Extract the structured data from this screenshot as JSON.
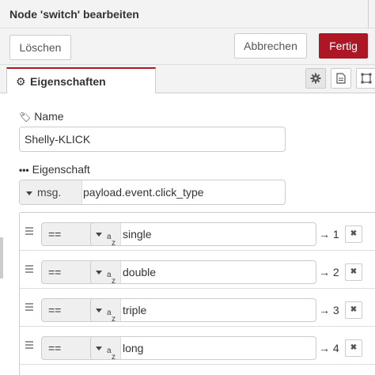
{
  "dialog": {
    "title": "Node 'switch' bearbeiten"
  },
  "actions": {
    "delete_label": "Löschen",
    "cancel_label": "Abbrechen",
    "done_label": "Fertig"
  },
  "tabs": {
    "properties_label": "Eigenschaften",
    "icons": [
      "gear-icon",
      "description-icon",
      "appearance-icon"
    ]
  },
  "form": {
    "name_label": "Name",
    "name_value": "Shelly-KLICK",
    "property_label": "Eigenschaft",
    "property_type": "msg.",
    "property_value": "payload.event.click_type"
  },
  "rules": [
    {
      "operator": "==",
      "value_type": "az",
      "value": "single",
      "output": "→ 1"
    },
    {
      "operator": "==",
      "value_type": "az",
      "value": "double",
      "output": "→ 2"
    },
    {
      "operator": "==",
      "value_type": "az",
      "value": "triple",
      "output": "→ 3"
    },
    {
      "operator": "==",
      "value_type": "az",
      "value": "long",
      "output": "→ 4"
    }
  ],
  "colors": {
    "accent": "#ad1625",
    "panel_bg": "#f3f3f3",
    "border": "#cccccc"
  }
}
